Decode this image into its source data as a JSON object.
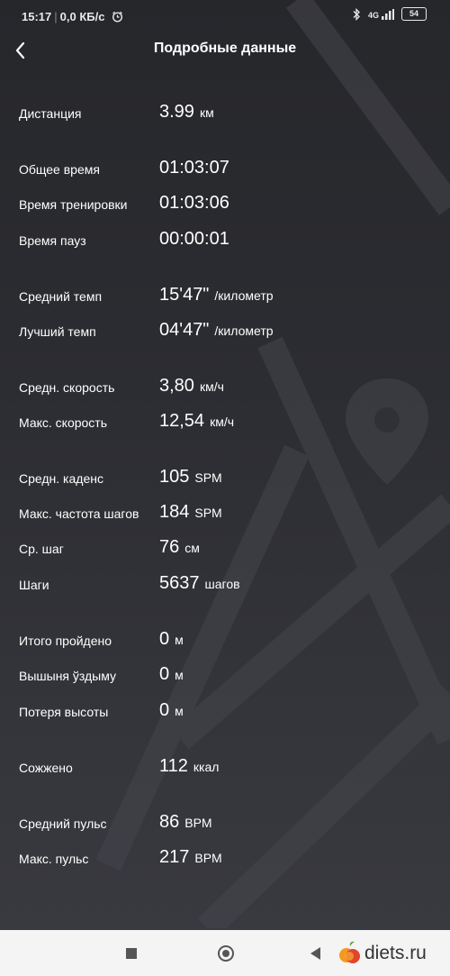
{
  "status_bar": {
    "time": "15:17",
    "speed": "0,0 КБ/с",
    "network": "4G",
    "battery": "54"
  },
  "header": {
    "title": "Подробные данные"
  },
  "rows": [
    {
      "label": "Дистанция",
      "value": "3.99",
      "unit": "км"
    },
    {
      "label": "Общее время",
      "value": "01:03:07",
      "unit": ""
    },
    {
      "label": "Время тренировки",
      "value": "01:03:06",
      "unit": ""
    },
    {
      "label": "Время пауз",
      "value": "00:00:01",
      "unit": ""
    },
    {
      "label": "Средний темп",
      "value": "15'47\"",
      "unit": "/километр"
    },
    {
      "label": "Лучший темп",
      "value": "04'47\"",
      "unit": "/километр"
    },
    {
      "label": "Средн. скорость",
      "value": "3,80",
      "unit": "км/ч"
    },
    {
      "label": "Макс. скорость",
      "value": "12,54",
      "unit": "км/ч"
    },
    {
      "label": "Средн. каденс",
      "value": "105",
      "unit": "SPM"
    },
    {
      "label": "Макс. частота шагов",
      "value": "184",
      "unit": "SPM"
    },
    {
      "label": "Ср. шаг",
      "value": "76",
      "unit": "см"
    },
    {
      "label": "Шаги",
      "value": "5637",
      "unit": "шагов"
    },
    {
      "label": "Итого пройдено",
      "value": "0",
      "unit": "м"
    },
    {
      "label": "Вышыня ўздыму",
      "value": "0",
      "unit": "м"
    },
    {
      "label": "Потеря высоты",
      "value": "0",
      "unit": "м"
    },
    {
      "label": "Сожжено",
      "value": "112",
      "unit": "ккал"
    },
    {
      "label": "Средний пульс",
      "value": "86",
      "unit": "BPM"
    },
    {
      "label": "Макс. пульс",
      "value": "217",
      "unit": "BPM"
    }
  ],
  "watermark": {
    "text": "diets.ru"
  },
  "colors": {
    "background": "#2c2d32",
    "text": "#ffffff",
    "navbar": "#f4f4f4"
  }
}
